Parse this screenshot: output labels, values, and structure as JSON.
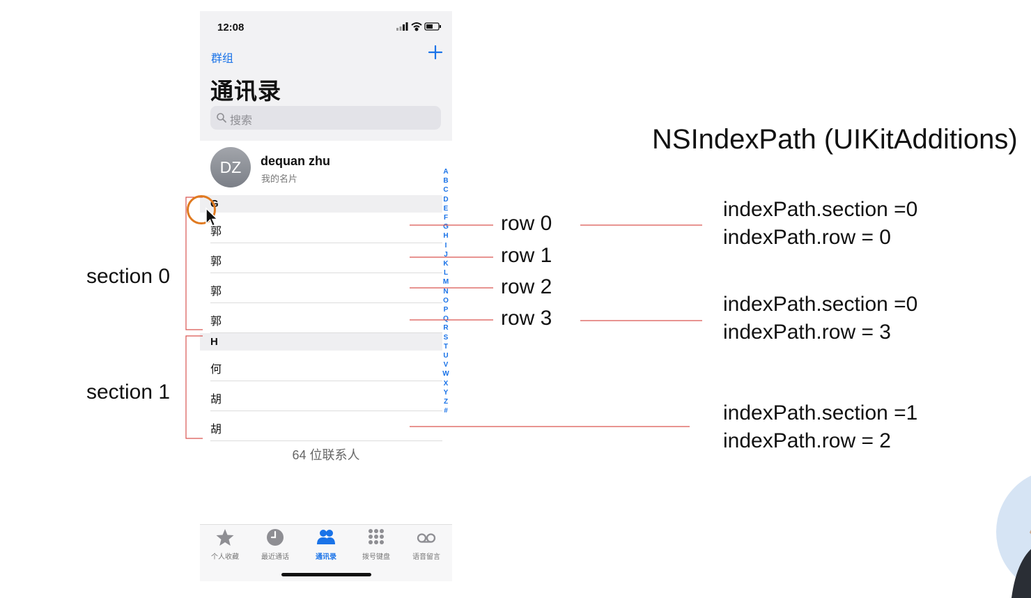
{
  "status": {
    "time": "12:08"
  },
  "nav": {
    "groups_label": "群组",
    "title": "通讯录"
  },
  "search": {
    "placeholder": "搜索"
  },
  "my_card": {
    "initials": "DZ",
    "name": "dequan zhu",
    "subtitle": "我的名片"
  },
  "sections": [
    {
      "header": "G",
      "rows": [
        "郭",
        "郭",
        "郭",
        "郭"
      ]
    },
    {
      "header": "H",
      "rows": [
        "何",
        "胡",
        "胡"
      ]
    }
  ],
  "index_letters": [
    "A",
    "B",
    "C",
    "D",
    "E",
    "F",
    "G",
    "H",
    "I",
    "J",
    "K",
    "L",
    "M",
    "N",
    "O",
    "P",
    "Q",
    "R",
    "S",
    "T",
    "U",
    "V",
    "W",
    "X",
    "Y",
    "Z",
    "#"
  ],
  "contact_count": "64 位联系人",
  "tabs": [
    {
      "label": "个人收藏",
      "icon": "star-icon",
      "active": false
    },
    {
      "label": "最近通话",
      "icon": "clock-icon",
      "active": false
    },
    {
      "label": "通讯录",
      "icon": "contacts-icon",
      "active": true
    },
    {
      "label": "拨号键盘",
      "icon": "keypad-icon",
      "active": false
    },
    {
      "label": "语音留言",
      "icon": "voicemail-icon",
      "active": false
    }
  ],
  "annotations": {
    "heading": "NSIndexPath (UIKitAdditions)",
    "section_labels": [
      "section 0",
      "section 1"
    ],
    "row_labels": [
      "row 0",
      "row 1",
      "row 2",
      "row 3"
    ],
    "index_paths": [
      {
        "section": "indexPath.section =0",
        "row": "indexPath.row = 0"
      },
      {
        "section": "indexPath.section =0",
        "row": "indexPath.row = 3"
      },
      {
        "section": "indexPath.section =1",
        "row": "indexPath.row = 2"
      }
    ]
  },
  "colors": {
    "ios_blue": "#1a73e8",
    "annotation_line": "#d9534f",
    "cursor_ring": "#e07a20"
  }
}
